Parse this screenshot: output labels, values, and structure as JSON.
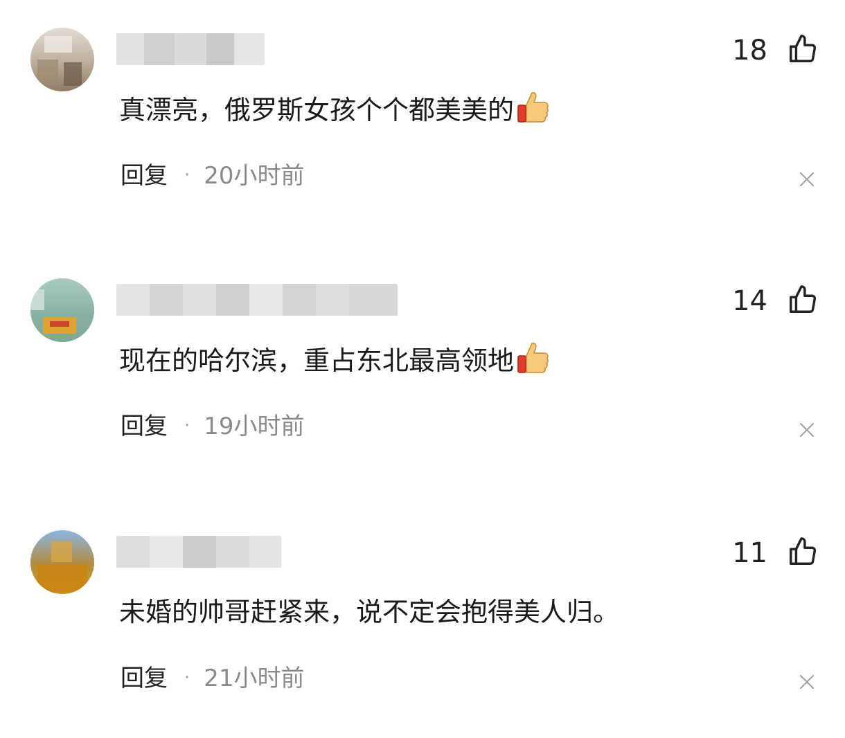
{
  "comments": [
    {
      "username": "",
      "text": "真漂亮，俄罗斯女孩个个都美美的",
      "emoji": "thumbs-up-emoji",
      "likes": "18",
      "reply_label": "回复",
      "separator": "·",
      "time": "20小时前"
    },
    {
      "username": "",
      "text": "现在的哈尔滨，重占东北最高领地",
      "emoji": "thumbs-up-emoji",
      "likes": "14",
      "reply_label": "回复",
      "separator": "·",
      "time": "19小时前"
    },
    {
      "username": "",
      "text": "未婚的帅哥赶紧来，说不定会抱得美人归。",
      "emoji": "",
      "likes": "11",
      "reply_label": "回复",
      "separator": "·",
      "time": "21小时前"
    }
  ],
  "icons": {
    "like": "thumbs-up-outline-icon",
    "close": "close-icon"
  },
  "colors": {
    "text": "#1a1a1a",
    "meta": "#8a8a8a",
    "icon": "#222222"
  }
}
